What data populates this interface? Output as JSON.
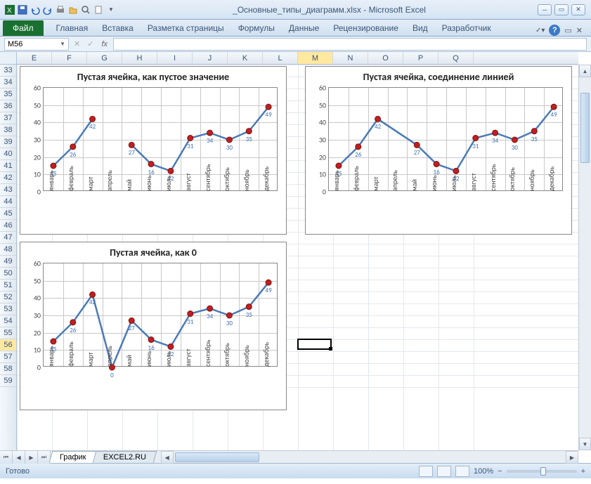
{
  "window": {
    "title": "_Основные_типы_диаграмм.xlsx - Microsoft Excel"
  },
  "ribbon": {
    "file": "Файл",
    "tabs": [
      "Главная",
      "Вставка",
      "Разметка страницы",
      "Формулы",
      "Данные",
      "Рецензирование",
      "Вид",
      "Разработчик"
    ]
  },
  "namebox": "M56",
  "columns": [
    "E",
    "F",
    "G",
    "H",
    "I",
    "J",
    "K",
    "L",
    "M",
    "N",
    "O",
    "P",
    "Q"
  ],
  "selected_col": "M",
  "rows": [
    "33",
    "34",
    "35",
    "36",
    "37",
    "38",
    "39",
    "40",
    "41",
    "42",
    "43",
    "44",
    "45",
    "46",
    "47",
    "48",
    "49",
    "50",
    "51",
    "52",
    "53",
    "54",
    "55",
    "56",
    "57",
    "58",
    "59"
  ],
  "selected_row": "56",
  "active_cell": {
    "col": "M",
    "row": "56"
  },
  "sheets": {
    "active": "График",
    "other": "EXCEL2.RU"
  },
  "status": {
    "ready": "Готово",
    "zoom": "100%"
  },
  "chart_data": [
    {
      "title": "Пустая ячейка, как пустое значение",
      "type": "line",
      "categories": [
        "январь",
        "февраль",
        "март",
        "апрель",
        "май",
        "июнь",
        "июль",
        "август",
        "сентябрь",
        "октябрь",
        "ноябрь",
        "декабрь"
      ],
      "values": [
        15,
        26,
        42,
        null,
        27,
        16,
        12,
        31,
        34,
        30,
        35,
        49
      ],
      "ylim": [
        0,
        60
      ],
      "ytick": 10,
      "gap_mode": "gap"
    },
    {
      "title": "Пустая ячейка, соединение линией",
      "type": "line",
      "categories": [
        "январь",
        "февраль",
        "март",
        "апрель",
        "май",
        "июнь",
        "июль",
        "август",
        "сентябрь",
        "октябрь",
        "ноябрь",
        "декабрь"
      ],
      "values": [
        15,
        26,
        42,
        null,
        27,
        16,
        12,
        31,
        34,
        30,
        35,
        49
      ],
      "ylim": [
        0,
        60
      ],
      "ytick": 10,
      "gap_mode": "connect"
    },
    {
      "title": "Пустая ячейка, как 0",
      "type": "line",
      "categories": [
        "январь",
        "февраль",
        "март",
        "апрель",
        "май",
        "июнь",
        "июль",
        "август",
        "сентябрь",
        "октябрь",
        "ноябрь",
        "декабрь"
      ],
      "values": [
        15,
        26,
        42,
        null,
        27,
        16,
        12,
        31,
        34,
        30,
        35,
        49
      ],
      "ylim": [
        0,
        60
      ],
      "ytick": 10,
      "gap_mode": "zero"
    }
  ]
}
